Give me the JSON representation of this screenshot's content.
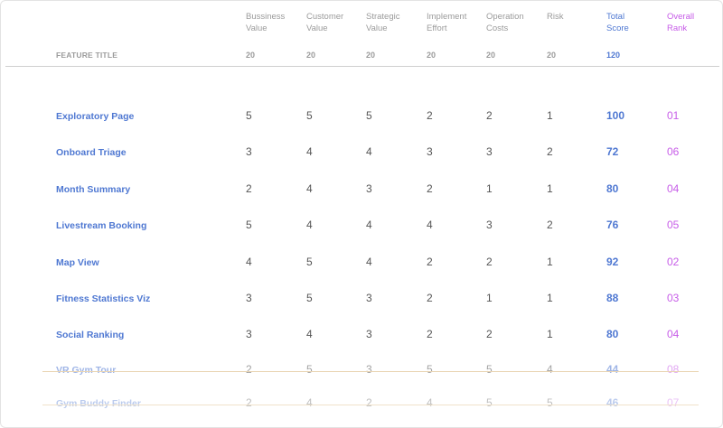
{
  "table": {
    "feature_title_header": "FEATURE TITLE",
    "columns": [
      {
        "label_1": "Bussiness",
        "label_2": "Value",
        "weight": "20"
      },
      {
        "label_1": "Customer",
        "label_2": "Value",
        "weight": "20"
      },
      {
        "label_1": "Strategic",
        "label_2": "Value",
        "weight": "20"
      },
      {
        "label_1": "Implement",
        "label_2": "Effort",
        "weight": "20"
      },
      {
        "label_1": "Operation",
        "label_2": "Costs",
        "weight": "20"
      },
      {
        "label_1": "Risk",
        "label_2": "",
        "weight": "20"
      }
    ],
    "total_column": {
      "label_1": "Total",
      "label_2": "Score",
      "weight": "120"
    },
    "rank_column": {
      "label_1": "Overall",
      "label_2": "Rank"
    },
    "rows": [
      {
        "feature": "Exploratory Page",
        "values": [
          "5",
          "5",
          "5",
          "2",
          "2",
          "1"
        ],
        "total": "100",
        "rank": "01"
      },
      {
        "feature": "Onboard Triage",
        "values": [
          "3",
          "4",
          "4",
          "3",
          "3",
          "2"
        ],
        "total": "72",
        "rank": "06"
      },
      {
        "feature": "Month Summary",
        "values": [
          "2",
          "4",
          "3",
          "2",
          "1",
          "1"
        ],
        "total": "80",
        "rank": "04"
      },
      {
        "feature": "Livestream Booking",
        "values": [
          "5",
          "4",
          "4",
          "4",
          "3",
          "2"
        ],
        "total": "76",
        "rank": "05"
      },
      {
        "feature": "Map View",
        "values": [
          "4",
          "5",
          "4",
          "2",
          "2",
          "1"
        ],
        "total": "92",
        "rank": "02"
      },
      {
        "feature": "Fitness Statistics Viz",
        "values": [
          "3",
          "5",
          "3",
          "2",
          "1",
          "1"
        ],
        "total": "88",
        "rank": "03"
      },
      {
        "feature": "Social Ranking",
        "values": [
          "3",
          "4",
          "3",
          "2",
          "2",
          "1"
        ],
        "total": "80",
        "rank": "04"
      },
      {
        "feature": "VR Gym Tour",
        "values": [
          "2",
          "5",
          "3",
          "5",
          "5",
          "4"
        ],
        "total": "44",
        "rank": "08"
      },
      {
        "feature": "Gym Buddy Finder",
        "values": [
          "2",
          "4",
          "2",
          "4",
          "5",
          "5"
        ],
        "total": "46",
        "rank": "07"
      }
    ]
  }
}
